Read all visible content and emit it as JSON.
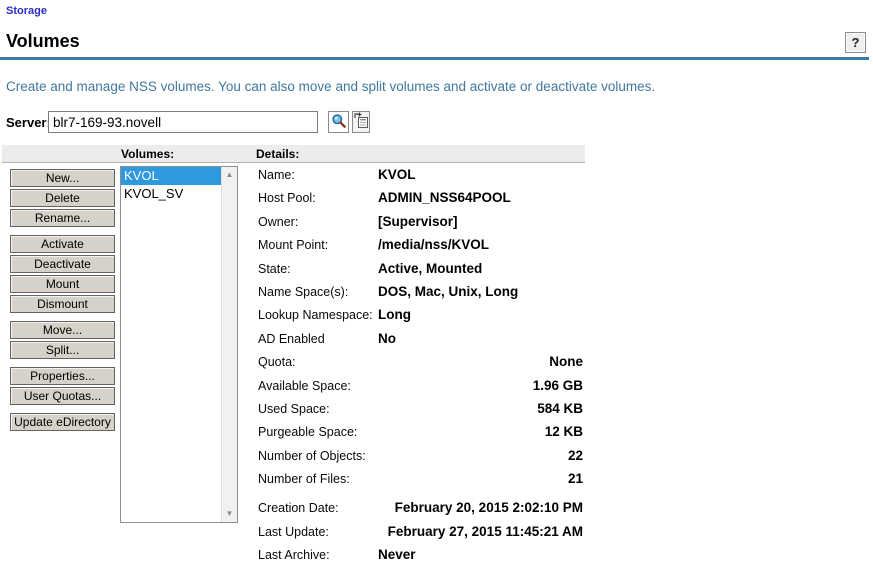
{
  "breadcrumb": {
    "label": "Storage"
  },
  "page": {
    "title": "Volumes",
    "help_label": "?",
    "description": "Create and manage NSS volumes. You can also move and split volumes and activate or deactivate volumes."
  },
  "server": {
    "label": "Server:",
    "value": "blr7-169-93.novell",
    "selector_icon": "magnifier-object-selector",
    "history_icon": "object-history"
  },
  "panels": {
    "volumes_header": "Volumes:",
    "details_header": "Details:"
  },
  "actions": {
    "groups": [
      {
        "buttons": [
          "New...",
          "Delete",
          "Rename..."
        ]
      },
      {
        "buttons": [
          "Activate",
          "Deactivate",
          "Mount",
          "Dismount"
        ]
      },
      {
        "buttons": [
          "Move...",
          "Split..."
        ]
      },
      {
        "buttons": [
          "Properties...",
          "User Quotas..."
        ]
      },
      {
        "buttons": [
          "Update eDirectory"
        ]
      }
    ]
  },
  "volumes": {
    "items": [
      {
        "name": "KVOL",
        "selected": true
      },
      {
        "name": "KVOL_SV",
        "selected": false
      }
    ]
  },
  "details": {
    "rows": [
      {
        "label": "Name:",
        "value": "KVOL",
        "align": "left"
      },
      {
        "label": "Host Pool:",
        "value": "ADMIN_NSS64POOL",
        "align": "left"
      },
      {
        "label": "Owner:",
        "value": "[Supervisor]",
        "align": "left"
      },
      {
        "label": "Mount Point:",
        "value": "/media/nss/KVOL",
        "align": "left"
      },
      {
        "label": "State:",
        "value": "Active, Mounted",
        "align": "left"
      },
      {
        "label": "Name Space(s):",
        "value": "DOS, Mac, Unix, Long",
        "align": "left"
      },
      {
        "label": "Lookup Namespace:",
        "value": "Long",
        "align": "left"
      },
      {
        "label": "AD Enabled",
        "value": "No",
        "align": "left"
      },
      {
        "label": "Quota:",
        "value": "None",
        "align": "right"
      },
      {
        "label": "Available Space:",
        "value": "1.96 GB",
        "align": "right"
      },
      {
        "label": "Used Space:",
        "value": "584 KB",
        "align": "right"
      },
      {
        "label": "Purgeable Space:",
        "value": "12 KB",
        "align": "right"
      },
      {
        "label": "Number of Objects:",
        "value": "22",
        "align": "right"
      },
      {
        "label": "Number of Files:",
        "value": "21",
        "align": "right"
      },
      {
        "label": "Creation Date:",
        "value": "February 20, 2015 2:02:10 PM",
        "align": "right",
        "gap_before": true
      },
      {
        "label": "Last Update:",
        "value": "February 27, 2015 11:45:21 AM",
        "align": "right"
      },
      {
        "label": "Last Archive:",
        "value": "Never",
        "align": "left"
      }
    ]
  },
  "colors": {
    "link": "#2b2bc8",
    "accent_rule": "#4179a5",
    "description_text": "#41789f",
    "header_bar": "#ececec",
    "button_face": "#d6d2c9",
    "selection": "#2f99e0"
  }
}
